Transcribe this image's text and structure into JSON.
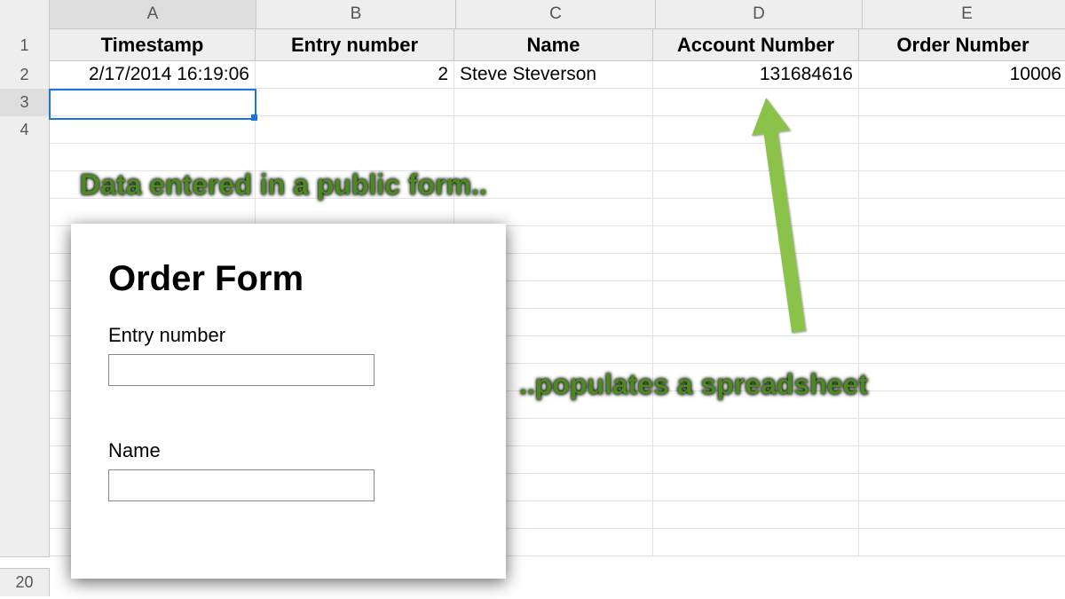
{
  "columns": {
    "A": "A",
    "B": "B",
    "C": "C",
    "D": "D",
    "E": "E"
  },
  "headers": {
    "A": "Timestamp",
    "B": "Entry number",
    "C": "Name",
    "D": "Account Number",
    "E": "Order Number"
  },
  "rows": {
    "r1": "1",
    "r2": "2",
    "r3": "3",
    "r4": "4",
    "r20": "20"
  },
  "dataRow": {
    "A": "2/17/2014 16:19:06",
    "B": "2",
    "C": "Steve Steverson",
    "D": "131684616",
    "E": "10006"
  },
  "selection": {
    "row": 3,
    "col": "A"
  },
  "annotations": {
    "top": "Data entered in a public form..",
    "bottom": "..populates a spreadsheet"
  },
  "form": {
    "title": "Order Form",
    "field1_label": "Entry number",
    "field1_value": "",
    "field2_label": "Name",
    "field2_value": ""
  }
}
